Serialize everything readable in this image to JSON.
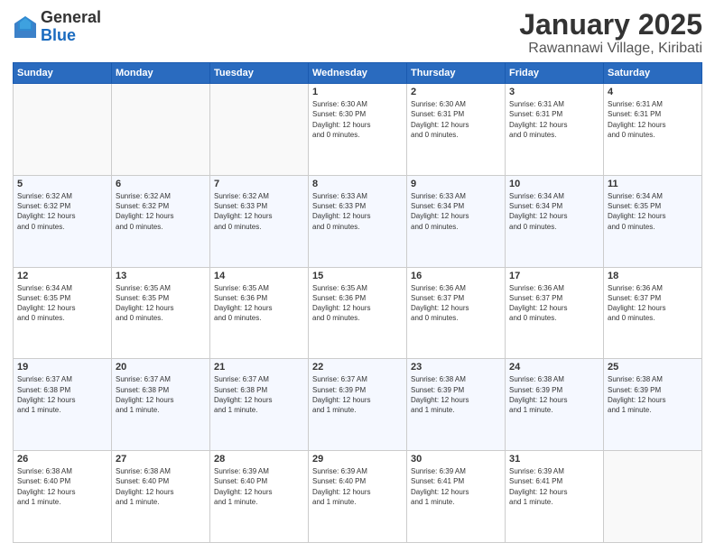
{
  "header": {
    "logo_general": "General",
    "logo_blue": "Blue",
    "title": "January 2025",
    "subtitle": "Rawannawi Village, Kiribati"
  },
  "days_of_week": [
    "Sunday",
    "Monday",
    "Tuesday",
    "Wednesday",
    "Thursday",
    "Friday",
    "Saturday"
  ],
  "weeks": [
    [
      {
        "day": "",
        "info": ""
      },
      {
        "day": "",
        "info": ""
      },
      {
        "day": "",
        "info": ""
      },
      {
        "day": "1",
        "info": "Sunrise: 6:30 AM\nSunset: 6:30 PM\nDaylight: 12 hours\nand 0 minutes."
      },
      {
        "day": "2",
        "info": "Sunrise: 6:30 AM\nSunset: 6:31 PM\nDaylight: 12 hours\nand 0 minutes."
      },
      {
        "day": "3",
        "info": "Sunrise: 6:31 AM\nSunset: 6:31 PM\nDaylight: 12 hours\nand 0 minutes."
      },
      {
        "day": "4",
        "info": "Sunrise: 6:31 AM\nSunset: 6:31 PM\nDaylight: 12 hours\nand 0 minutes."
      }
    ],
    [
      {
        "day": "5",
        "info": "Sunrise: 6:32 AM\nSunset: 6:32 PM\nDaylight: 12 hours\nand 0 minutes."
      },
      {
        "day": "6",
        "info": "Sunrise: 6:32 AM\nSunset: 6:32 PM\nDaylight: 12 hours\nand 0 minutes."
      },
      {
        "day": "7",
        "info": "Sunrise: 6:32 AM\nSunset: 6:33 PM\nDaylight: 12 hours\nand 0 minutes."
      },
      {
        "day": "8",
        "info": "Sunrise: 6:33 AM\nSunset: 6:33 PM\nDaylight: 12 hours\nand 0 minutes."
      },
      {
        "day": "9",
        "info": "Sunrise: 6:33 AM\nSunset: 6:34 PM\nDaylight: 12 hours\nand 0 minutes."
      },
      {
        "day": "10",
        "info": "Sunrise: 6:34 AM\nSunset: 6:34 PM\nDaylight: 12 hours\nand 0 minutes."
      },
      {
        "day": "11",
        "info": "Sunrise: 6:34 AM\nSunset: 6:35 PM\nDaylight: 12 hours\nand 0 minutes."
      }
    ],
    [
      {
        "day": "12",
        "info": "Sunrise: 6:34 AM\nSunset: 6:35 PM\nDaylight: 12 hours\nand 0 minutes."
      },
      {
        "day": "13",
        "info": "Sunrise: 6:35 AM\nSunset: 6:35 PM\nDaylight: 12 hours\nand 0 minutes."
      },
      {
        "day": "14",
        "info": "Sunrise: 6:35 AM\nSunset: 6:36 PM\nDaylight: 12 hours\nand 0 minutes."
      },
      {
        "day": "15",
        "info": "Sunrise: 6:35 AM\nSunset: 6:36 PM\nDaylight: 12 hours\nand 0 minutes."
      },
      {
        "day": "16",
        "info": "Sunrise: 6:36 AM\nSunset: 6:37 PM\nDaylight: 12 hours\nand 0 minutes."
      },
      {
        "day": "17",
        "info": "Sunrise: 6:36 AM\nSunset: 6:37 PM\nDaylight: 12 hours\nand 0 minutes."
      },
      {
        "day": "18",
        "info": "Sunrise: 6:36 AM\nSunset: 6:37 PM\nDaylight: 12 hours\nand 0 minutes."
      }
    ],
    [
      {
        "day": "19",
        "info": "Sunrise: 6:37 AM\nSunset: 6:38 PM\nDaylight: 12 hours\nand 1 minute."
      },
      {
        "day": "20",
        "info": "Sunrise: 6:37 AM\nSunset: 6:38 PM\nDaylight: 12 hours\nand 1 minute."
      },
      {
        "day": "21",
        "info": "Sunrise: 6:37 AM\nSunset: 6:38 PM\nDaylight: 12 hours\nand 1 minute."
      },
      {
        "day": "22",
        "info": "Sunrise: 6:37 AM\nSunset: 6:39 PM\nDaylight: 12 hours\nand 1 minute."
      },
      {
        "day": "23",
        "info": "Sunrise: 6:38 AM\nSunset: 6:39 PM\nDaylight: 12 hours\nand 1 minute."
      },
      {
        "day": "24",
        "info": "Sunrise: 6:38 AM\nSunset: 6:39 PM\nDaylight: 12 hours\nand 1 minute."
      },
      {
        "day": "25",
        "info": "Sunrise: 6:38 AM\nSunset: 6:39 PM\nDaylight: 12 hours\nand 1 minute."
      }
    ],
    [
      {
        "day": "26",
        "info": "Sunrise: 6:38 AM\nSunset: 6:40 PM\nDaylight: 12 hours\nand 1 minute."
      },
      {
        "day": "27",
        "info": "Sunrise: 6:38 AM\nSunset: 6:40 PM\nDaylight: 12 hours\nand 1 minute."
      },
      {
        "day": "28",
        "info": "Sunrise: 6:39 AM\nSunset: 6:40 PM\nDaylight: 12 hours\nand 1 minute."
      },
      {
        "day": "29",
        "info": "Sunrise: 6:39 AM\nSunset: 6:40 PM\nDaylight: 12 hours\nand 1 minute."
      },
      {
        "day": "30",
        "info": "Sunrise: 6:39 AM\nSunset: 6:41 PM\nDaylight: 12 hours\nand 1 minute."
      },
      {
        "day": "31",
        "info": "Sunrise: 6:39 AM\nSunset: 6:41 PM\nDaylight: 12 hours\nand 1 minute."
      },
      {
        "day": "",
        "info": ""
      }
    ]
  ]
}
